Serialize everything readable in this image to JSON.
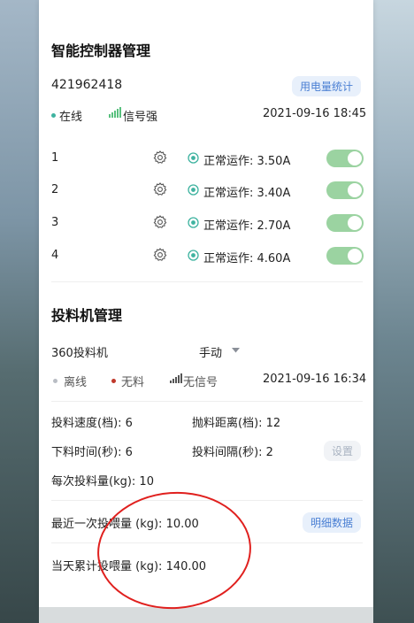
{
  "controller": {
    "title": "智能控制器管理",
    "device_id": "421962418",
    "stats_button": "用电量统计",
    "status_online": "在线",
    "signal": "信号强",
    "timestamp": "2021-09-16 18:45",
    "channels": [
      {
        "number": "1",
        "status": "正常运作: 3.50A",
        "on": true
      },
      {
        "number": "2",
        "status": "正常运作: 3.40A",
        "on": true
      },
      {
        "number": "3",
        "status": "正常运作: 2.70A",
        "on": true
      },
      {
        "number": "4",
        "status": "正常运作: 4.60A",
        "on": true
      }
    ]
  },
  "feeder": {
    "title": "投料机管理",
    "machine_name": "360投料机",
    "mode_value": "手动",
    "status_offline": "离线",
    "material": "无料",
    "signal": "无信号",
    "timestamp": "2021-09-16 16:34",
    "speed": "投料速度(档): 6",
    "throw_distance": "抛料距离(档): 12",
    "feed_time": "下料时间(秒): 6",
    "feed_interval": "投料间隔(秒): 2",
    "settings_button": "设置",
    "per_feed": "每次投料量(kg): 10",
    "last_feed": "最近一次投喂量 (kg): 10.00",
    "detail_button": "明细数据",
    "today_total": "当天累计投喂量 (kg): 140.00"
  },
  "colors": {
    "accent": "#4a7fd3",
    "online": "#3fb3a0",
    "toggle_on": "#9bd3a1",
    "material_dot": "#c0392b",
    "annotation_ring": "#e0201e"
  }
}
